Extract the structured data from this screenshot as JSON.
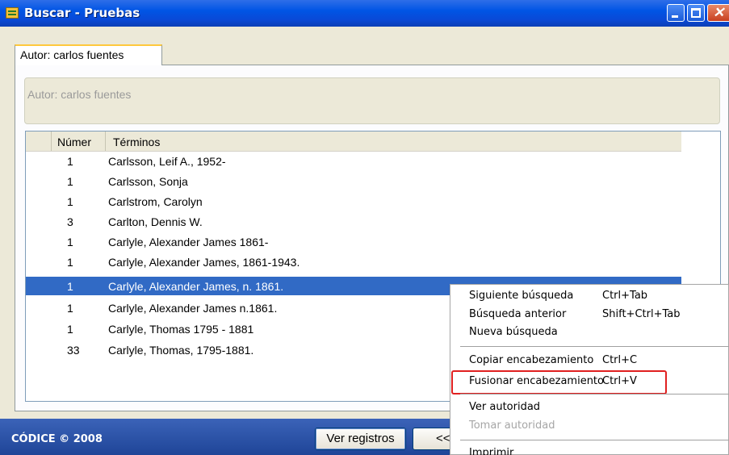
{
  "window": {
    "title": "Buscar  - Pruebas"
  },
  "tab": {
    "label": "Autor: carlos fuentes"
  },
  "search_label": "Autor: carlos fuentes",
  "grid": {
    "columns": [
      "Númer",
      "Términos"
    ],
    "rows": [
      {
        "num": "1",
        "term": "Carlsson, Leif A., 1952-"
      },
      {
        "num": "1",
        "term": "Carlsson, Sonja"
      },
      {
        "num": "1",
        "term": "Carlstrom, Carolyn"
      },
      {
        "num": "3",
        "term": "Carlton, Dennis W."
      },
      {
        "num": "1",
        "term": "Carlyle, Alexander James 1861-"
      },
      {
        "num": "1",
        "term": "Carlyle, Alexander James, 1861-1943."
      },
      {
        "num": "1",
        "term": "Carlyle, Alexander James, n. 1861."
      },
      {
        "num": "1",
        "term": "Carlyle, Alexander James n.1861."
      },
      {
        "num": "1",
        "term": "Carlyle, Thomas 1795 - 1881"
      },
      {
        "num": "33",
        "term": "Carlyle, Thomas, 1795-1881."
      }
    ],
    "selected_index": 6
  },
  "statusbar": {
    "text": "CÓDICE © 2008",
    "ver_registros": "Ver registros",
    "prev": "<<"
  },
  "context_menu": {
    "items": [
      {
        "label": "Siguiente búsqueda",
        "shortcut": "Ctrl+Tab"
      },
      {
        "label": "Búsqueda anterior",
        "shortcut": "Shift+Ctrl+Tab"
      },
      {
        "label": "Nueva búsqueda",
        "shortcut": ""
      },
      {
        "label": "Copiar encabezamiento",
        "shortcut": "Ctrl+C"
      },
      {
        "label": "Fusionar encabezamiento",
        "shortcut": "Ctrl+V"
      },
      {
        "label": "Ver autoridad",
        "shortcut": ""
      },
      {
        "label": "Tomar autoridad",
        "shortcut": ""
      },
      {
        "label": "Imprimir",
        "shortcut": ""
      }
    ]
  },
  "colors": {
    "titlebar": "#0055e5",
    "selection": "#316ac5",
    "highlight_box": "#e02020",
    "statusbar": "#2a52a8"
  },
  "icons": [
    "app-icon",
    "minimize-icon",
    "maximize-icon",
    "close-icon"
  ]
}
